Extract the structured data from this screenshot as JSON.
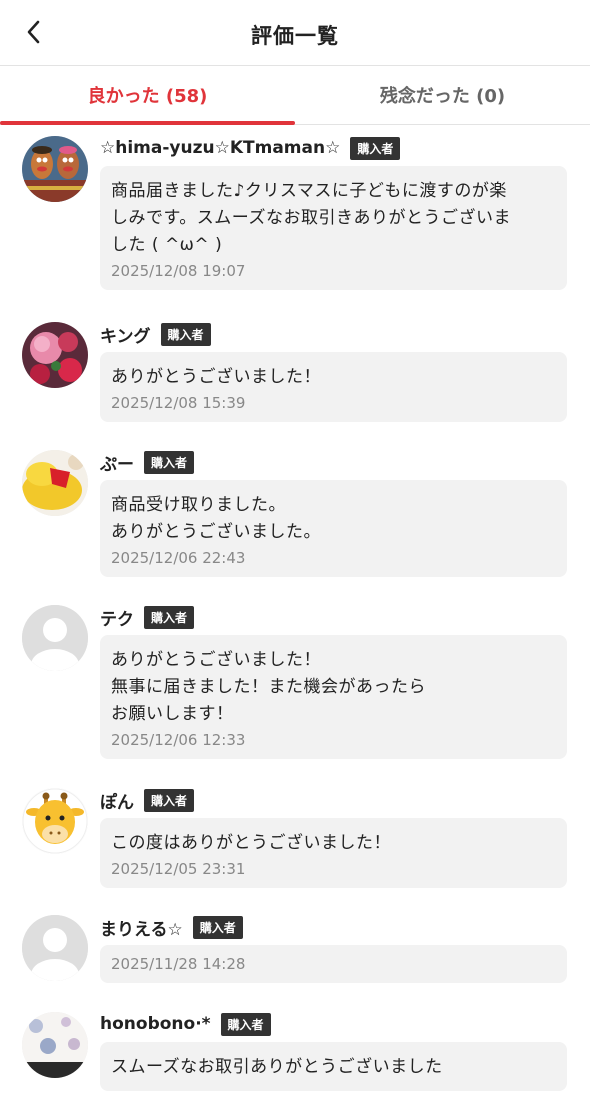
{
  "header": {
    "title": "評価一覧",
    "back_icon": "chevron-left-icon"
  },
  "tabs": [
    {
      "label": "良かった (58)",
      "active": true
    },
    {
      "label": "残念だった (0)",
      "active": false
    }
  ],
  "reviews": [
    {
      "username": "☆hima-yuzu☆KTmaman☆",
      "badge": "購入者",
      "avatar": "toy-figures-photo",
      "comment": "商品届きました♪クリスマスに子どもに渡すのが楽\nしみです。スムーズなお取引きありがとうございま\nした ( ^ω^ )",
      "timestamp": "2025/12/08 19:07"
    },
    {
      "username": "キング",
      "badge": "購入者",
      "avatar": "flowers-photo",
      "comment": "ありがとうございました！",
      "timestamp": "2025/12/08 15:39"
    },
    {
      "username": "ぷー",
      "badge": "購入者",
      "avatar": "plush-toy-photo",
      "comment": "商品受け取りました。\nありがとうございました。",
      "timestamp": "2025/12/06 22:43"
    },
    {
      "username": "テク",
      "badge": "購入者",
      "avatar": "default-user-icon",
      "comment": "ありがとうございました！\n無事に届きました！また機会があったら\nお願いします！",
      "timestamp": "2025/12/06 12:33"
    },
    {
      "username": "ぽん",
      "badge": "購入者",
      "avatar": "giraffe-icon",
      "comment": "この度はありがとうございました！",
      "timestamp": "2025/12/05 23:31"
    },
    {
      "username": "まりえる☆",
      "badge": "購入者",
      "avatar": "default-user-icon",
      "comment": "",
      "timestamp": "2025/11/28 14:28"
    },
    {
      "username": "honobono·*",
      "badge": "購入者",
      "avatar": "floral-pattern-photo",
      "comment": "スムーズなお取引ありがとうございました",
      "timestamp": ""
    }
  ]
}
